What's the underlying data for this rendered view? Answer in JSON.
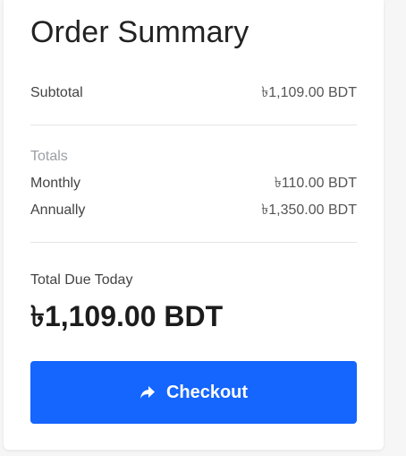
{
  "summary": {
    "title": "Order Summary",
    "subtotal_label": "Subtotal",
    "subtotal_value": "৳1,109.00 BDT",
    "totals_label": "Totals",
    "monthly_label": "Monthly",
    "monthly_value": "৳110.00 BDT",
    "annually_label": "Annually",
    "annually_value": "৳1,350.00 BDT",
    "due_label": "Total Due Today",
    "due_amount": "৳1,109.00 BDT",
    "checkout_label": "Checkout",
    "checkout_icon": "share-forward-icon",
    "accent_color": "#1565ff"
  }
}
